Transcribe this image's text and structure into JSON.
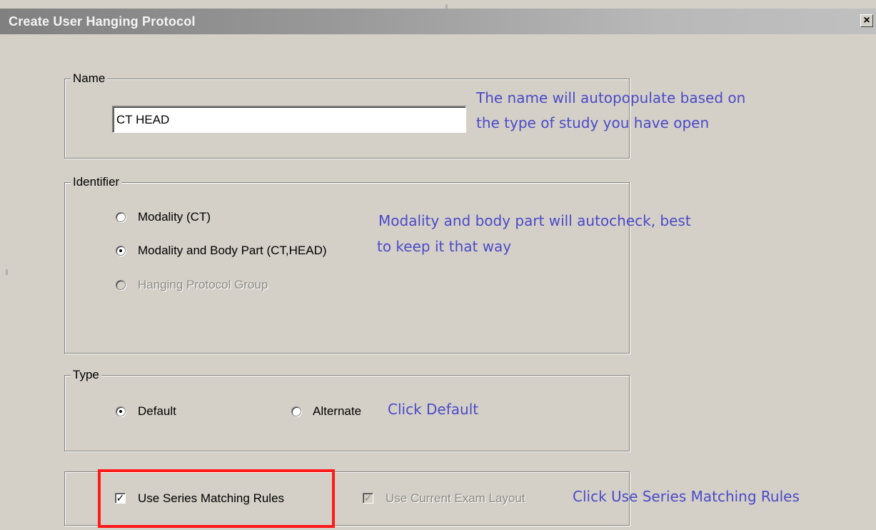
{
  "window": {
    "title": "Create User Hanging Protocol",
    "close_label": "×"
  },
  "name_group": {
    "legend": "Name",
    "value": "CT HEAD"
  },
  "identifier_group": {
    "legend": "Identifier",
    "options": [
      {
        "label": "Modality (CT)",
        "checked": false,
        "enabled": true
      },
      {
        "label": "Modality and Body Part (CT,HEAD)",
        "checked": true,
        "enabled": true
      },
      {
        "label": "Hanging Protocol Group",
        "checked": false,
        "enabled": false
      }
    ]
  },
  "type_group": {
    "legend": "Type",
    "options": [
      {
        "label": "Default",
        "checked": true
      },
      {
        "label": "Alternate",
        "checked": false
      }
    ]
  },
  "options_group": {
    "use_series_matching_rules": {
      "label": "Use Series Matching Rules",
      "checked": true,
      "enabled": true
    },
    "use_current_exam_layout": {
      "label": "Use Current Exam Layout",
      "checked": true,
      "enabled": false
    }
  },
  "annotations": {
    "name_note_line1": "The name will autopopulate based on",
    "name_note_line2": "the type of study you have open",
    "identifier_note_line1": "Modality and body part will autocheck, best",
    "identifier_note_line2": "to keep it that way",
    "type_note": "Click Default",
    "rules_note": "Click Use Series Matching Rules",
    "annotation_color": "#4a4ac8",
    "highlight_color": "#ff1a1a"
  }
}
